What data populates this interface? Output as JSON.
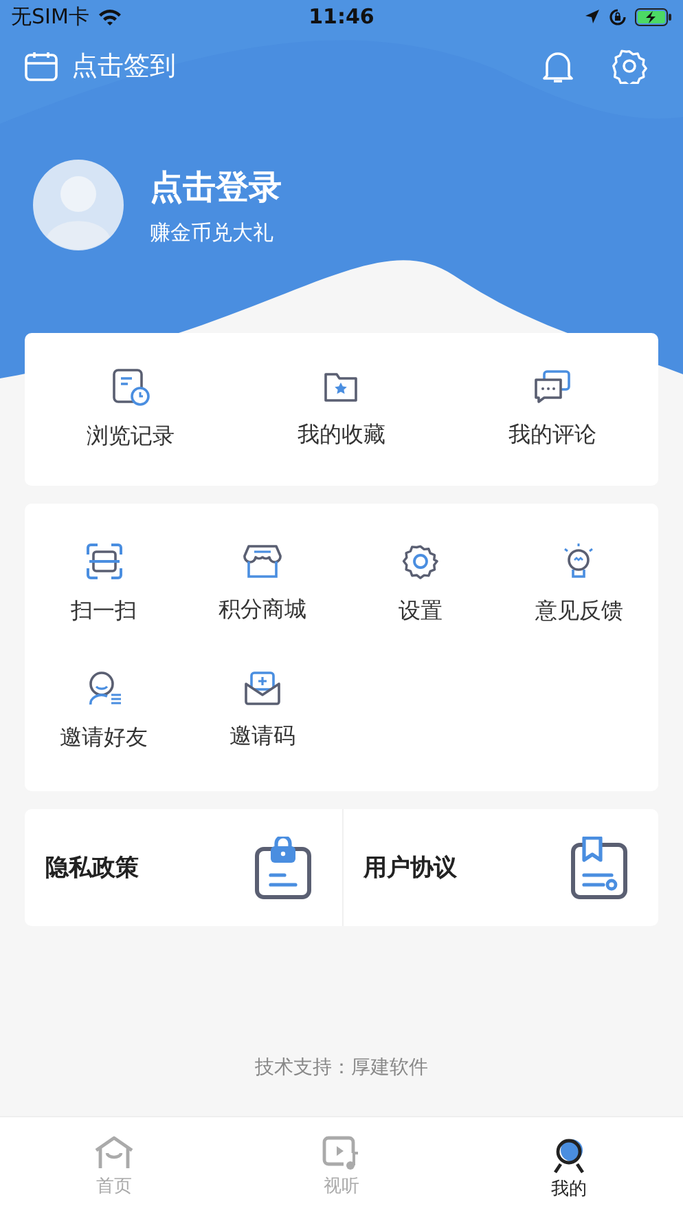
{
  "status_bar": {
    "carrier": "无SIM卡",
    "time": "11:46"
  },
  "top_bar": {
    "checkin": "点击签到"
  },
  "profile": {
    "name": "点击登录",
    "subtitle": "赚金币兑大礼"
  },
  "quick_links": [
    {
      "label": "浏览记录"
    },
    {
      "label": "我的收藏"
    },
    {
      "label": "我的评论"
    }
  ],
  "services": [
    {
      "label": "扫一扫"
    },
    {
      "label": "积分商城"
    },
    {
      "label": "设置"
    },
    {
      "label": "意见反馈"
    },
    {
      "label": "邀请好友"
    },
    {
      "label": "邀请码"
    }
  ],
  "documents": [
    {
      "label": "隐私政策"
    },
    {
      "label": "用户协议"
    }
  ],
  "footer": "技术支持：厚建软件",
  "tab_bar": [
    {
      "label": "首页",
      "selected": false
    },
    {
      "label": "视听",
      "selected": false
    },
    {
      "label": "我的",
      "selected": true
    }
  ]
}
